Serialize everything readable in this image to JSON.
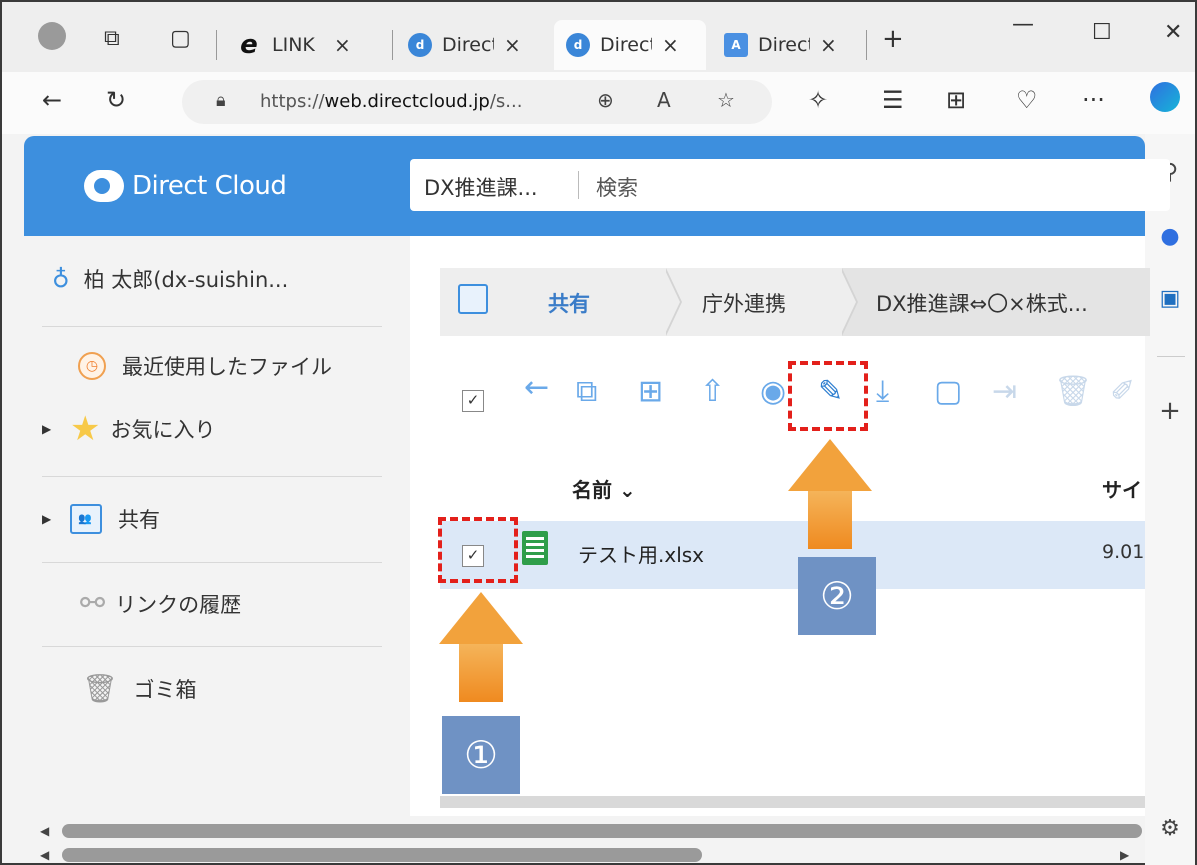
{
  "browser": {
    "tabs": [
      {
        "title": "LINK",
        "close": "×",
        "favicon": "e"
      },
      {
        "title": "Direct",
        "close": "×",
        "favicon": "d"
      },
      {
        "title": "Direct",
        "close": "×",
        "favicon": "d"
      },
      {
        "title": "Direct",
        "close": "×",
        "favicon": "A"
      }
    ],
    "new_tab": "+",
    "window": {
      "minimize": "—",
      "maximize": "☐",
      "close": "✕"
    },
    "url_prefix": "https://",
    "url_host": "web.directcloud.jp",
    "url_rest": "/s...",
    "more": "···"
  },
  "app": {
    "logo_text": "Direct Cloud",
    "search_scope": "DX推進課...",
    "search_placeholder": "検索"
  },
  "sidebar": {
    "user": "柏  太郎(dx-suishin...",
    "recent": "最近使用したファイル",
    "favorites": "お気に入り",
    "shared": "共有",
    "link_history": "リンクの履歴",
    "trash": "ゴミ箱"
  },
  "breadcrumb": {
    "items": [
      "共有",
      "庁外連携",
      "DX推進課⇔〇×株式..."
    ]
  },
  "toolbar": {
    "select_all": "✓"
  },
  "file_list": {
    "col_name": "名前 ⌄",
    "col_size": "サイ",
    "rows": [
      {
        "name": "テスト用.xlsx",
        "size": "9.01",
        "checked": "✓"
      }
    ]
  },
  "annotations": {
    "badge1": "①",
    "badge2": "②",
    "accent": "#e3201b"
  }
}
